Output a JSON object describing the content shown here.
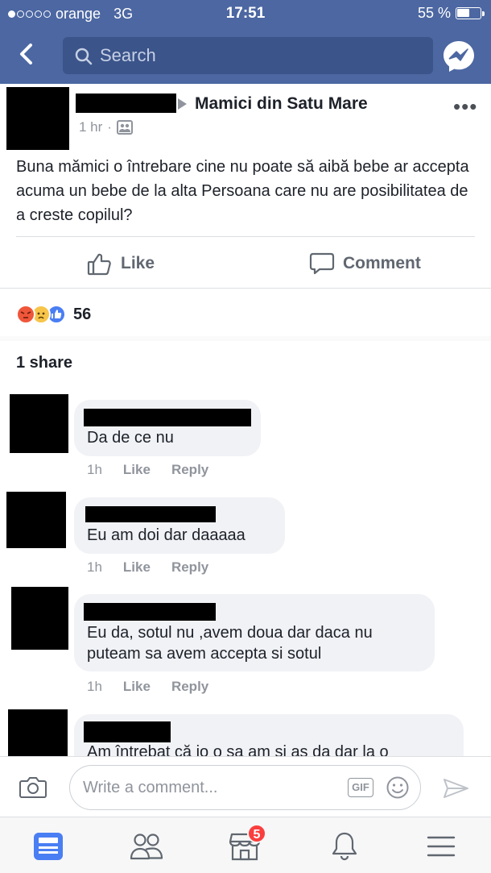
{
  "status_bar": {
    "carrier": "orange",
    "network": "3G",
    "time": "17:51",
    "battery": "55 %",
    "battery_level": 0.55,
    "signal_bars": 1
  },
  "nav": {
    "search_placeholder": "Search"
  },
  "post": {
    "group": "Mamici din Satu Mare",
    "time": "1 hr",
    "text": "Buna mămici o întrebare cine nu poate să aibă bebe ar accepta acuma un bebe de la alta Persoana care nu are posibilitatea de a creste copilul?",
    "like_label": "Like",
    "comment_label": "Comment",
    "reaction_count": "56",
    "reactions": [
      "angry",
      "sad",
      "like"
    ],
    "shares": "1 share"
  },
  "comments": [
    {
      "text": "Da de ce nu",
      "time": "1h",
      "like": "Like",
      "reply": "Reply"
    },
    {
      "text": "Eu am doi dar daaaaa",
      "time": "1h",
      "like": "Like",
      "reply": "Reply"
    },
    {
      "text": "Eu da, sotul nu ,avem doua dar daca nu puteam sa avem accepta si sotul",
      "time": "1h",
      "like": "Like",
      "reply": "Reply"
    },
    {
      "text": "Am întrebat că io o sa am si as da dar la o"
    }
  ],
  "composer": {
    "placeholder": "Write a comment...",
    "gif_label": "GIF"
  },
  "tabbar": {
    "marketplace_badge": "5"
  },
  "colors": {
    "header_blue": "#4c67a2",
    "search_blue": "#3b548a",
    "active_tab": "#4a7ef3",
    "badge_red": "#fa3e3e"
  }
}
